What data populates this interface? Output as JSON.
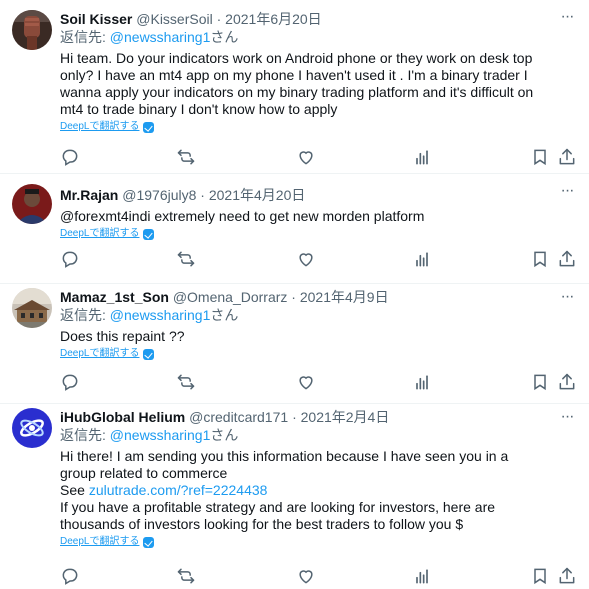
{
  "tweets": [
    {
      "name": "Soil Kisser",
      "handle": "@KisserSoil",
      "separator": "·",
      "date": "2021年6月20日",
      "reply_prefix": "返信先:",
      "reply_to": "@newssharing1",
      "reply_suffix": "さん",
      "lines": [
        "Hi team. Do your indicators work on Android phone or they work on desk top",
        "only? I have an mt4 app on my phone I haven't used it . I'm a binary trader I",
        "wanna apply your indicators on my binary trading platform and it's difficult on",
        "mt4 to trade binary I don't know how to apply"
      ],
      "translate": "DeepLで翻訳する",
      "avatar_icon": "fist-avatar-icon"
    },
    {
      "name": "Mr.Rajan",
      "handle": "@1976july8",
      "separator": "·",
      "date": "2021年4月20日",
      "lines": [
        "@forexmt4indi extremely need to get new morden platform"
      ],
      "translate": "DeepLで翻訳する",
      "avatar_icon": "person-avatar-icon"
    },
    {
      "name": "Mamaz_1st_Son",
      "handle": "@Omena_Dorrarz",
      "separator": "·",
      "date": "2021年4月9日",
      "reply_prefix": "返信先:",
      "reply_to": "@newssharing1",
      "reply_suffix": "さん",
      "lines": [
        "Does this repaint ??"
      ],
      "translate": "DeepLで翻訳する",
      "avatar_icon": "building-avatar-icon"
    },
    {
      "name": "iHubGlobal Helium",
      "handle": "@creditcard171",
      "separator": "·",
      "date": "2021年2月4日",
      "reply_prefix": "返信先:",
      "reply_to": "@newssharing1",
      "reply_suffix": "さん",
      "lines": [
        "Hi there! I am sending you this information because I have seen you in a",
        "group related to commerce"
      ],
      "see_prefix": "See ",
      "see_link": "zulutrade.com/?ref=2224438",
      "lines2": [
        "If you have a profitable strategy and are looking for investors, here are",
        "thousands of investors looking for the best traders to follow you $"
      ],
      "translate": "DeepLで翻訳する",
      "avatar_icon": "ihub-logo-avatar-icon"
    }
  ],
  "more_label": "···",
  "colors": {
    "text": "#0f1419",
    "secondary": "#536471",
    "accent": "#1d9bf0",
    "divider": "#eff3f4"
  },
  "action_icons": [
    "reply-icon",
    "retweet-icon",
    "like-icon",
    "analytics-icon",
    "bookmark-icon",
    "share-icon"
  ]
}
